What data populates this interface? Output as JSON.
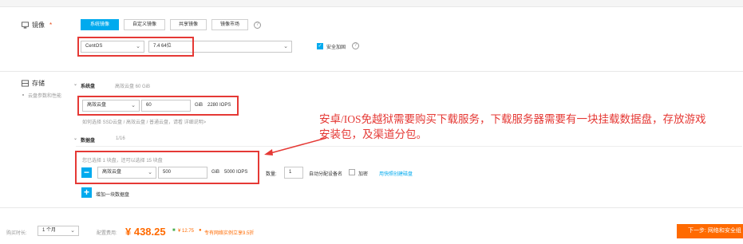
{
  "image_section": {
    "label": "镜像",
    "required_mark": "*",
    "tabs": [
      "系统镜像",
      "自定义镜像",
      "共享镜像",
      "镜像市场"
    ],
    "os": "CentOS",
    "version": "7.4 64位",
    "security_label": "安全加固"
  },
  "storage": {
    "label": "存储",
    "hint": "云盘参数和性能",
    "system_disk": {
      "title": "系统盘",
      "desc": "高效云盘 60 GiB",
      "type": "高效云盘",
      "size": "60",
      "unit": "GiB",
      "iops": "2280 IOPS",
      "note": "如何选择 SSD云盘 / 高效云盘 / 普通云盘，请看 详细说明>"
    },
    "data_disk": {
      "title": "数据盘",
      "count": "1/16",
      "selected_note": "您已选择 1 块盘，还可以选择 15 块盘",
      "type": "高效云盘",
      "size": "500",
      "unit": "GiB",
      "iops": "5000 IOPS",
      "qty_label": "数量:",
      "qty": "1",
      "auto_assign": "自动分配设备名",
      "encrypt": "加密",
      "snapshot_link": "用快照创建磁盘",
      "add_label": "增加一块数据盘"
    }
  },
  "annotation": {
    "line1": "安卓/IOS免越狱需要购买下载服务，下载服务器需要有一块挂载数据盘，存放游戏",
    "line2": "安装包，及渠道分包。"
  },
  "footer": {
    "duration_label": "购买时长:",
    "duration_value": "1 个月",
    "price_label": "配置费用:",
    "price": "¥ 438.25",
    "extra_price": "¥ 12.75",
    "promo": "专有网络实例立享9.5折",
    "next_button": "下一步: 网络和安全组"
  },
  "colors": {
    "accent": "#00aaee",
    "annotation": "#e53935",
    "price": "#ff6a00"
  }
}
